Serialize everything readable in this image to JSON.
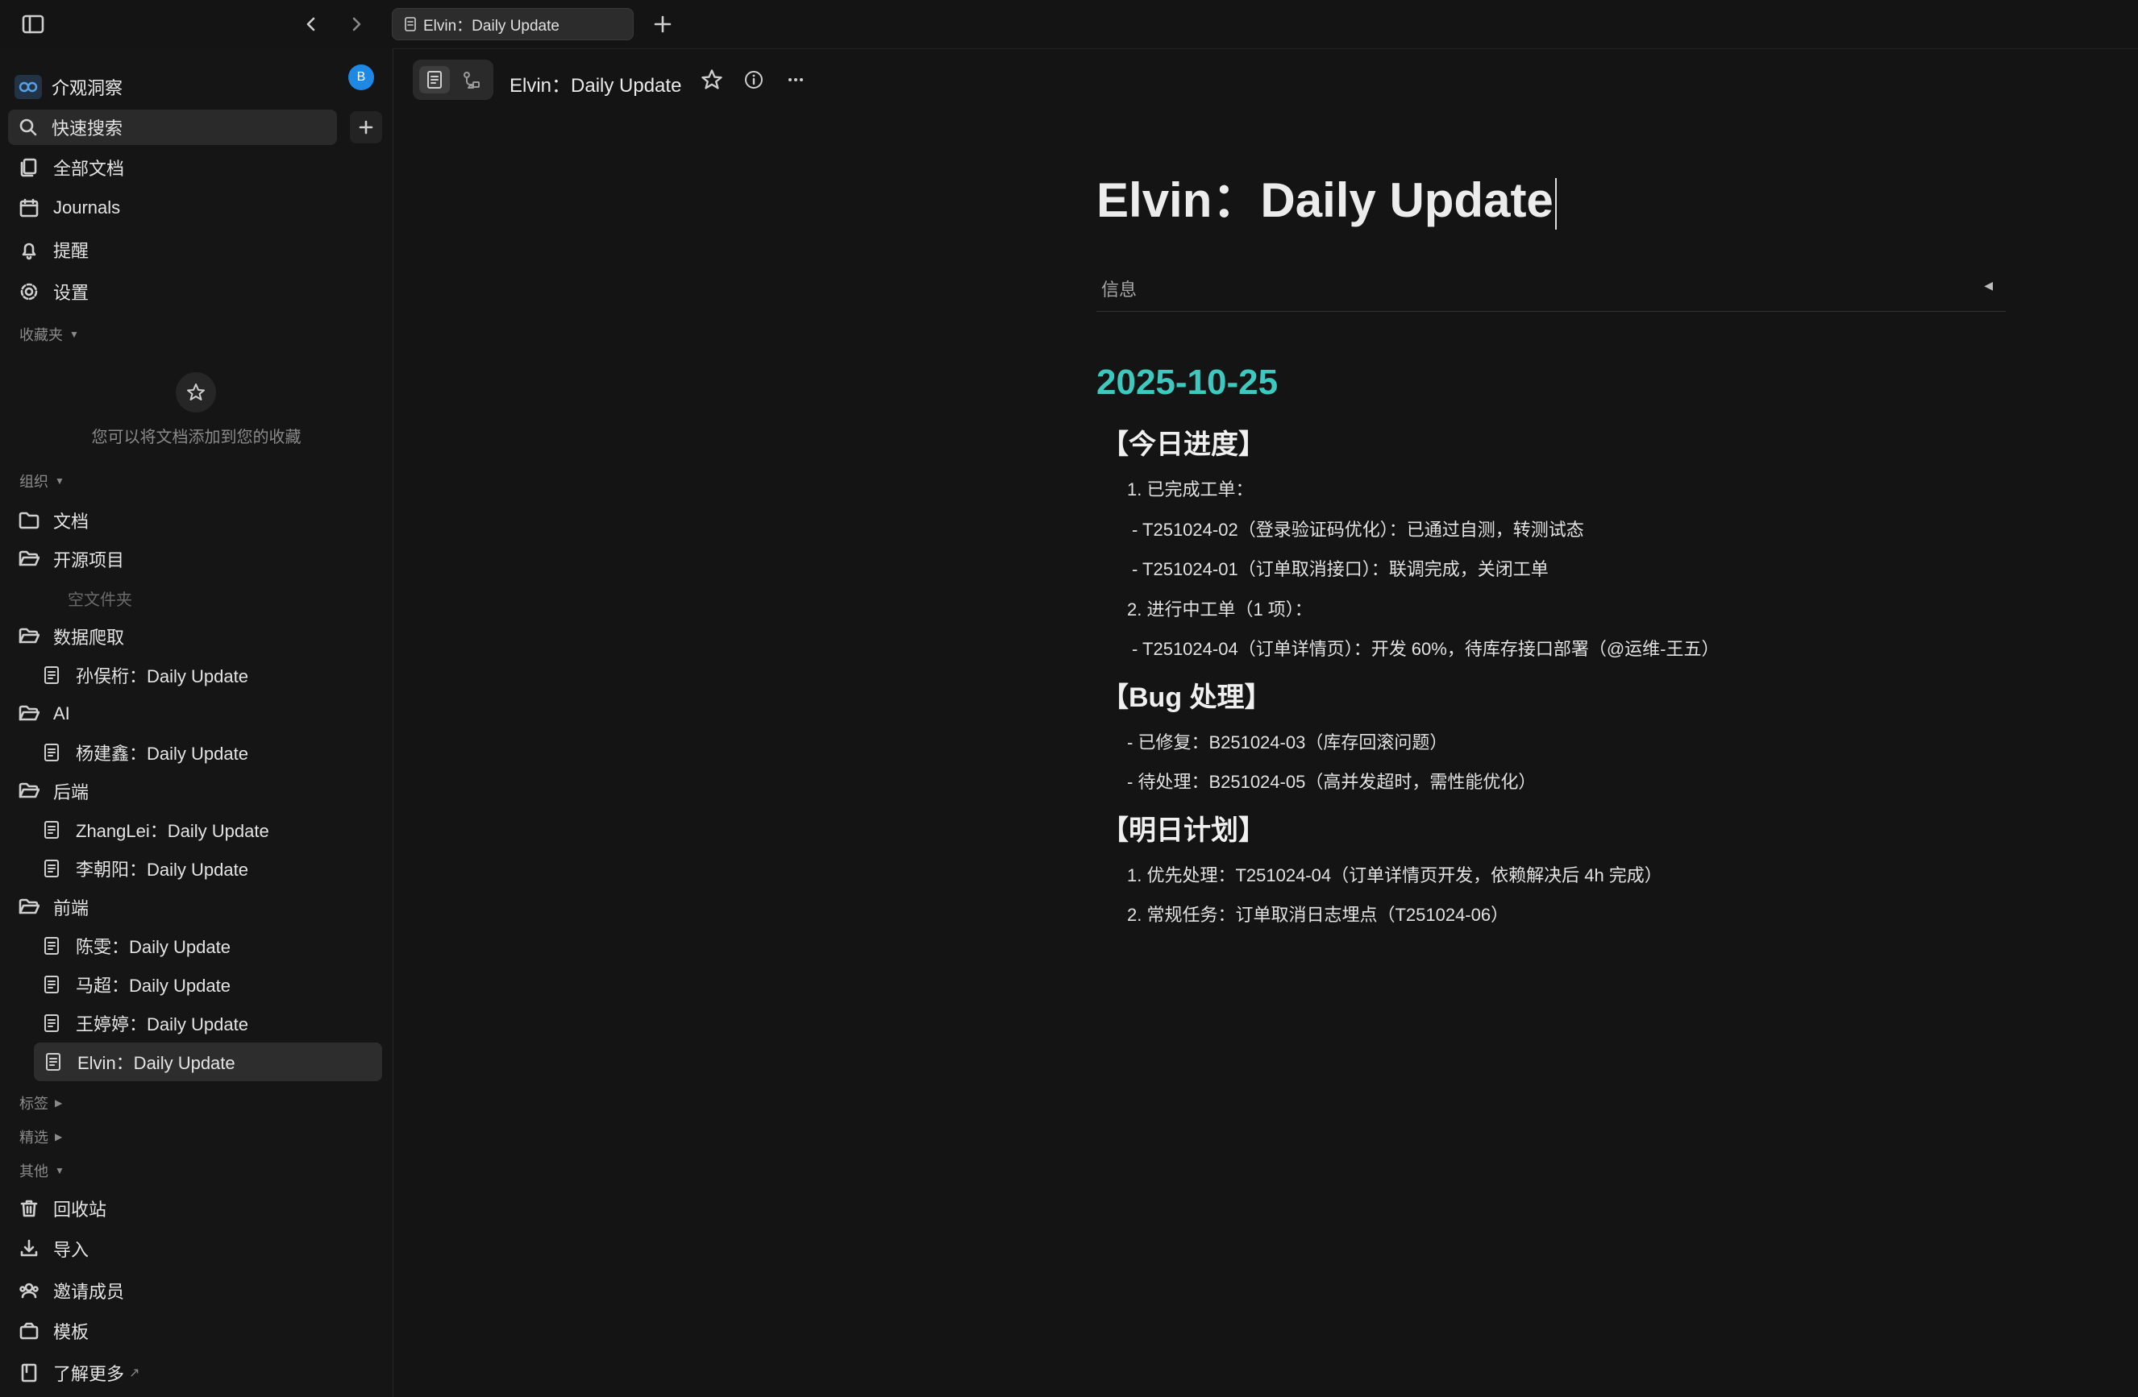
{
  "tabs": [
    {
      "label": "Elvin：Daily Update"
    }
  ],
  "workspace": {
    "name": "介观洞察",
    "avatar_letter": "B"
  },
  "sidebar": {
    "search_label": "快速搜索",
    "nav": [
      {
        "label": "全部文档",
        "icon": "all-docs-icon"
      },
      {
        "label": "Journals",
        "icon": "calendar-icon"
      },
      {
        "label": "提醒",
        "icon": "bell-icon"
      },
      {
        "label": "设置",
        "icon": "gear-icon"
      }
    ],
    "favorites": {
      "heading": "收藏夹",
      "empty_hint": "您可以将文档添加到您的收藏"
    },
    "org": {
      "heading": "组织",
      "items": [
        {
          "label": "文档",
          "kind": "folder"
        },
        {
          "label": "开源项目",
          "kind": "folder-open"
        },
        {
          "label": "空文件夹",
          "kind": "empty"
        },
        {
          "label": "数据爬取",
          "kind": "folder-open"
        },
        {
          "label": "孙俣桁：Daily Update",
          "kind": "doc"
        },
        {
          "label": "AI",
          "kind": "folder-open"
        },
        {
          "label": "杨建鑫：Daily Update",
          "kind": "doc"
        },
        {
          "label": "后端",
          "kind": "folder-open"
        },
        {
          "label": "ZhangLei：Daily Update",
          "kind": "doc"
        },
        {
          "label": "李朝阳：Daily Update",
          "kind": "doc"
        },
        {
          "label": "前端",
          "kind": "folder-open"
        },
        {
          "label": "陈雯：Daily Update",
          "kind": "doc"
        },
        {
          "label": "马超：Daily Update",
          "kind": "doc"
        },
        {
          "label": "王婷婷：Daily Update",
          "kind": "doc"
        },
        {
          "label": "Elvin：Daily Update",
          "kind": "doc-active"
        }
      ]
    },
    "tags_heading": "标签",
    "featured_heading": "精选",
    "other_heading": "其他",
    "other": [
      {
        "label": "回收站",
        "icon": "trash-icon"
      },
      {
        "label": "导入",
        "icon": "import-icon"
      },
      {
        "label": "邀请成员",
        "icon": "invite-members-icon"
      },
      {
        "label": "模板",
        "icon": "template-icon"
      },
      {
        "label": "了解更多",
        "icon": "book-icon"
      }
    ]
  },
  "toolbar": {
    "title": "Elvin：Daily Update"
  },
  "doc": {
    "title": "Elvin：Daily Update",
    "info_label": "信息",
    "date": "2025-10-25",
    "sections": [
      {
        "heading": "【今日进度】",
        "lines": [
          "1. 已完成工单：",
          "- T251024-02（登录验证码优化）：已通过自测，转测试态",
          "- T251024-01（订单取消接口）：联调完成，关闭工单",
          "2. 进行中工单（1 项）：",
          "- T251024-04（订单详情页）：开发 60%，待库存接口部署（@运维-王五）"
        ]
      },
      {
        "heading": "【Bug 处理】",
        "lines": [
          "- 已修复：B251024-03（库存回滚问题）",
          "- 待处理：B251024-05（高并发超时，需性能优化）"
        ]
      },
      {
        "heading": "【明日计划】",
        "lines": [
          "1. 优先处理：T251024-04（订单详情页开发，依赖解决后 4h 完成）",
          "2. 常规任务：订单取消日志埋点（T251024-06）"
        ]
      }
    ]
  },
  "colors": {
    "background": "#141414",
    "accent_date": "#3ec9c0",
    "avatar": "#1e88e5"
  }
}
